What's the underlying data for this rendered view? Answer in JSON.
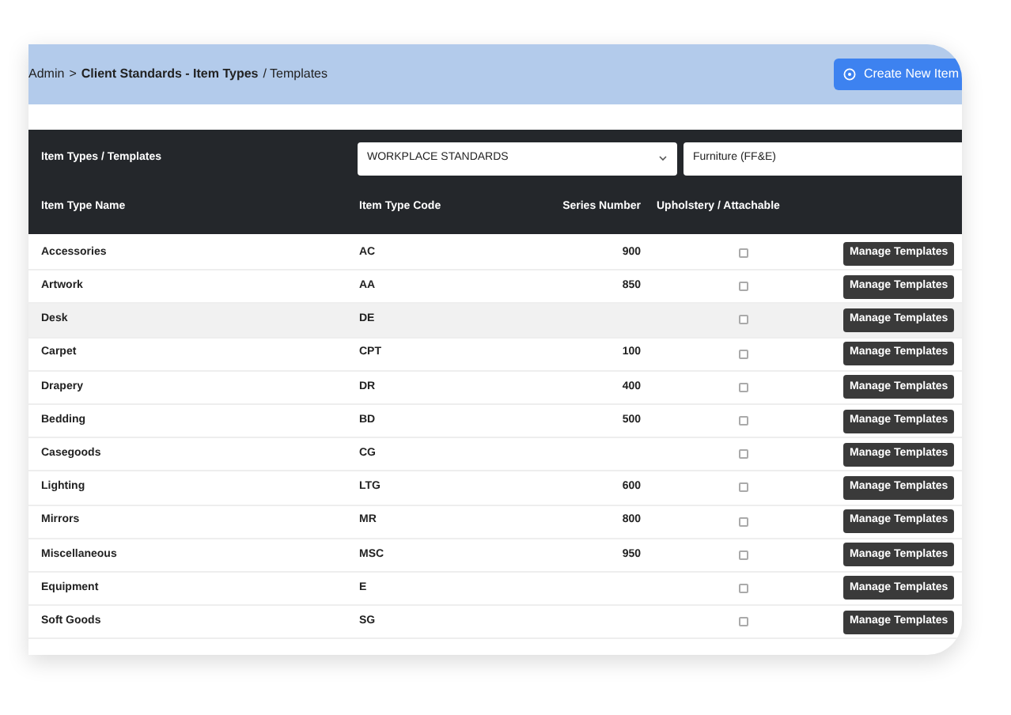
{
  "breadcrumb": {
    "root": "Admin",
    "separator": ">",
    "current": "Client Standards - Item Types",
    "suffix": "/ Templates"
  },
  "create_button": {
    "label": "Create New Item"
  },
  "filter_bar": {
    "title": "Item Types / Templates",
    "standard_select": {
      "value": "WORKPLACE STANDARDS"
    },
    "category_select": {
      "value": "Furniture (FF&E)"
    }
  },
  "table": {
    "columns": [
      "Item Type Name",
      "Item Type Code",
      "Series Number",
      "Upholstery / Attachable"
    ],
    "rows": [
      {
        "name": "Accessories",
        "code": "AC",
        "series": "900",
        "checked": false,
        "highlighted": false,
        "action": "Manage Templates"
      },
      {
        "name": "Artwork",
        "code": "AA",
        "series": "850",
        "checked": false,
        "highlighted": false,
        "action": "Manage Templates"
      },
      {
        "name": "Desk",
        "code": "DE",
        "series": "",
        "checked": false,
        "highlighted": true,
        "action": "Manage Templates"
      },
      {
        "name": "Carpet",
        "code": "CPT",
        "series": "100",
        "checked": false,
        "highlighted": false,
        "action": "Manage Templates"
      },
      {
        "name": "Drapery",
        "code": "DR",
        "series": "400",
        "checked": false,
        "highlighted": false,
        "action": "Manage Templates"
      },
      {
        "name": "Bedding",
        "code": "BD",
        "series": "500",
        "checked": false,
        "highlighted": false,
        "action": "Manage Templates"
      },
      {
        "name": "Casegoods",
        "code": "CG",
        "series": "",
        "checked": false,
        "highlighted": false,
        "action": "Manage Templates"
      },
      {
        "name": "Lighting",
        "code": "LTG",
        "series": "600",
        "checked": false,
        "highlighted": false,
        "action": "Manage Templates"
      },
      {
        "name": "Mirrors",
        "code": "MR",
        "series": "800",
        "checked": false,
        "highlighted": false,
        "action": "Manage Templates"
      },
      {
        "name": "Miscellaneous",
        "code": "MSC",
        "series": "950",
        "checked": false,
        "highlighted": false,
        "action": "Manage Templates"
      },
      {
        "name": "Equipment",
        "code": "E",
        "series": "",
        "checked": false,
        "highlighted": false,
        "action": "Manage Templates"
      },
      {
        "name": "Soft Goods",
        "code": "SG",
        "series": "",
        "checked": false,
        "highlighted": false,
        "action": "Manage Templates"
      }
    ]
  }
}
